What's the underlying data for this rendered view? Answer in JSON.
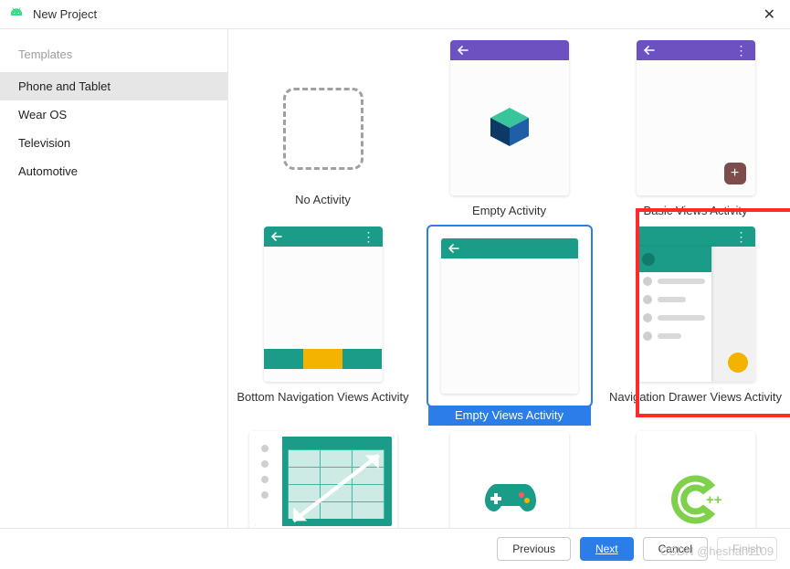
{
  "window": {
    "title": "New Project"
  },
  "sidebar": {
    "header": "Templates",
    "items": [
      "Phone and Tablet",
      "Wear OS",
      "Television",
      "Automotive"
    ],
    "selected_index": 0
  },
  "templates": {
    "row1": [
      "No Activity",
      "Empty Activity",
      "Basic Views Activity"
    ],
    "row2": [
      "Bottom Navigation Views Activity",
      "Empty Views Activity",
      "Navigation Drawer Views Activity"
    ],
    "selected": "Empty Views Activity"
  },
  "buttons": {
    "previous": "Previous",
    "next": "Next",
    "cancel": "Cancel",
    "finish": "Finish"
  },
  "misc": {
    "basic_fab": "+",
    "cpp_text": "++",
    "watermark": "CSDN @heshan1109"
  }
}
